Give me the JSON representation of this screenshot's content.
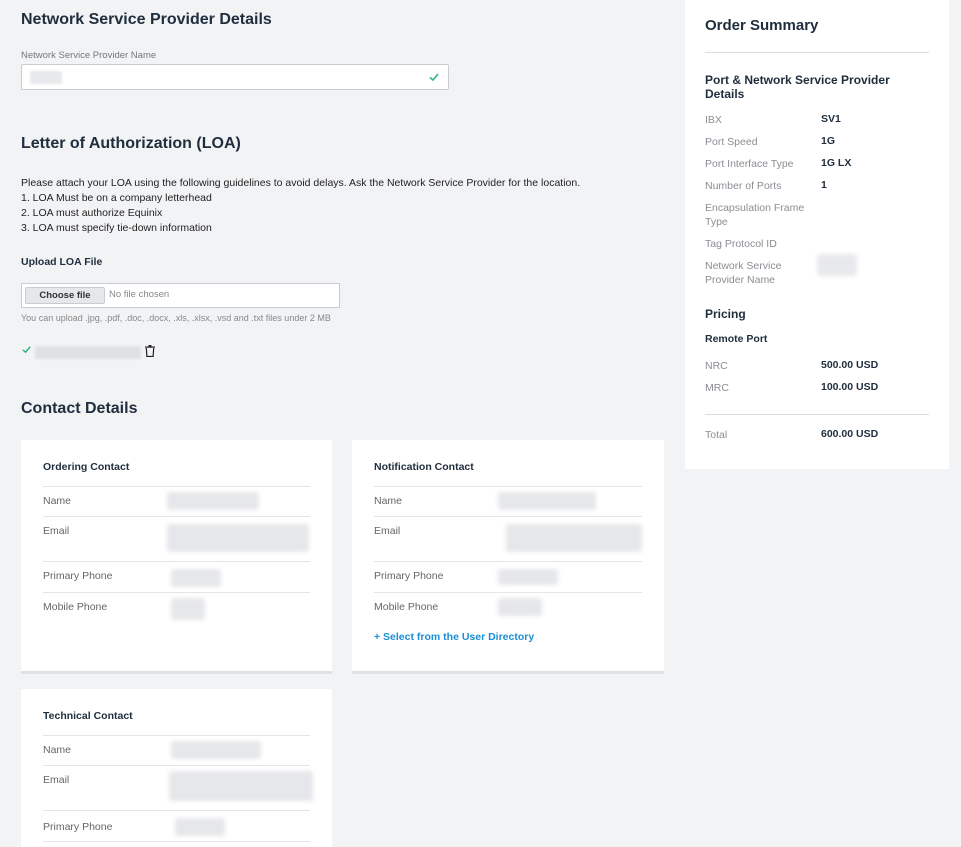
{
  "provider": {
    "section_title": "Network Service Provider Details",
    "name_label": "Network Service Provider Name"
  },
  "loa": {
    "section_title": "Letter of Authorization (LOA)",
    "instructions": "Please attach your LOA using the following guidelines to avoid delays. Ask the Network Service Provider for the location.",
    "guidelines": [
      "1. LOA Must be on a company letterhead",
      "2. LOA must authorize Equinix",
      "3. LOA must specify tie-down information"
    ],
    "upload_label": "Upload LOA File",
    "choose_file_button": "Choose file",
    "file_status": "No file chosen",
    "help_text": "You can upload .jpg, .pdf, .doc, .docx, .xls, .xlsx, .vsd and .txt files under 2 MB"
  },
  "contacts": {
    "section_title": "Contact Details",
    "ordering": {
      "title": "Ordering Contact",
      "labels": [
        "Name",
        "Email",
        "Primary Phone",
        "Mobile Phone"
      ]
    },
    "notification": {
      "title": "Notification Contact",
      "labels": [
        "Name",
        "Email",
        "Primary Phone",
        "Mobile Phone"
      ],
      "link": "+ Select from the User Directory"
    },
    "technical": {
      "title": "Technical Contact",
      "labels": [
        "Name",
        "Email",
        "Primary Phone"
      ]
    }
  },
  "summary": {
    "title": "Order Summary",
    "details_title": "Port & Network Service Provider Details",
    "rows": [
      {
        "label": "IBX",
        "value": "SV1"
      },
      {
        "label": "Port Speed",
        "value": "1G"
      },
      {
        "label": "Port Interface Type",
        "value": "1G LX"
      },
      {
        "label": "Number of Ports",
        "value": "1"
      },
      {
        "label": "Encapsulation Frame Type",
        "value": ""
      },
      {
        "label": "Tag Protocol ID",
        "value": ""
      },
      {
        "label": "Network Service Provider Name",
        "value": ""
      }
    ],
    "pricing_title": "Pricing",
    "remote_port_title": "Remote Port",
    "nrc_label": "NRC",
    "nrc_value": "500.00 USD",
    "mrc_label": "MRC",
    "mrc_value": "100.00 USD",
    "total_label": "Total",
    "total_value": "600.00 USD"
  },
  "colors": {
    "accent_link": "#1a8fd6",
    "success_check": "#2eb67d"
  }
}
